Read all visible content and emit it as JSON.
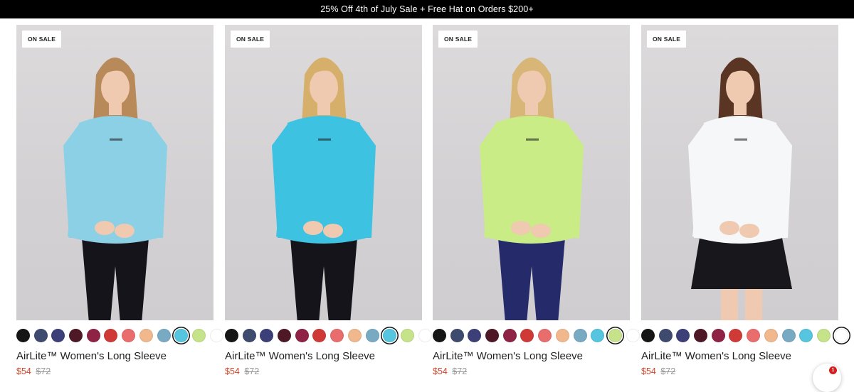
{
  "announcement": {
    "text": "25% Off 4th of July Sale + Free Hat on Orders $200+"
  },
  "products": [
    {
      "badge": "ON SALE",
      "title": "AirLite™ Women's Long Sleeve",
      "price": "$54",
      "compare_price": "$72",
      "image": {
        "hair": "#b88a5a",
        "shirt": "#8cd0e6",
        "bottom": "#14141a",
        "bottom_type": "leggings"
      },
      "selected_swatch": 9
    },
    {
      "badge": "ON SALE",
      "title": "AirLite™ Women's Long Sleeve",
      "price": "$54",
      "compare_price": "$72",
      "image": {
        "hair": "#d6b06a",
        "shirt": "#3ec2e2",
        "bottom": "#14141a",
        "bottom_type": "leggings"
      },
      "selected_swatch": 9
    },
    {
      "badge": "ON SALE",
      "title": "AirLite™ Women's Long Sleeve",
      "price": "$54",
      "compare_price": "$72",
      "image": {
        "hair": "#d8b677",
        "shirt": "#c9ec86",
        "bottom": "#252b6a",
        "bottom_type": "leggings"
      },
      "selected_swatch": 10
    },
    {
      "badge": "ON SALE",
      "title": "AirLite™ Women's Long Sleeve",
      "price": "$54",
      "compare_price": "$72",
      "image": {
        "hair": "#5a3524",
        "shirt": "#f6f7f9",
        "bottom": "#17171c",
        "bottom_type": "skirt"
      },
      "selected_swatch": 11
    }
  ],
  "swatch_colors": [
    "#151515",
    "#3e4a6e",
    "#3c3f78",
    "#4e1827",
    "#8e2345",
    "#cf3a37",
    "#ea6d6d",
    "#f1b88e",
    "#79aac4",
    "#55c5e0",
    "#c6e38a",
    "#ffffff"
  ],
  "chat_widget": {
    "badge_count": "1"
  }
}
